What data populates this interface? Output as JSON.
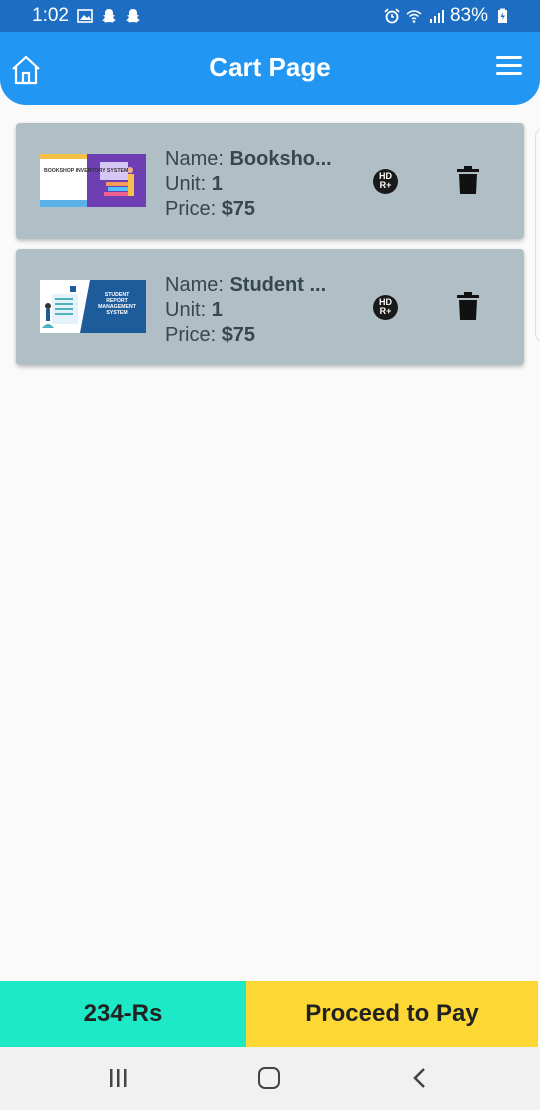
{
  "status": {
    "time": "1:02",
    "battery": "83%"
  },
  "header": {
    "title": "Cart Page"
  },
  "cart": {
    "items": [
      {
        "name_label": "Name: ",
        "name": "Booksho...",
        "unit_label": "Unit: ",
        "unit": "1",
        "price_label": "Price: ",
        "price": "$75",
        "thumb_text": "BOOKSHOP INVENTORY SYSTEM"
      },
      {
        "name_label": "Name: ",
        "name": "Student ...",
        "unit_label": "Unit: ",
        "unit": "1",
        "price_label": "Price: ",
        "price": "$75",
        "thumb_text": "STUDENT REPORT MANAGEMENT SYSTEM"
      }
    ],
    "badge_text": "HD R+"
  },
  "footer": {
    "total": "234-Rs",
    "pay_label": "Proceed to Pay"
  },
  "colors": {
    "appbar": "#2196f3",
    "statusbar": "#1d6ec2",
    "card": "#b0bec5",
    "total_bg": "#1de9c6",
    "pay_bg": "#fdd835"
  },
  "icons": [
    "home-icon",
    "menu-icon",
    "hd-badge-icon",
    "trash-icon",
    "recent-apps-icon",
    "home-nav-icon",
    "back-icon"
  ]
}
